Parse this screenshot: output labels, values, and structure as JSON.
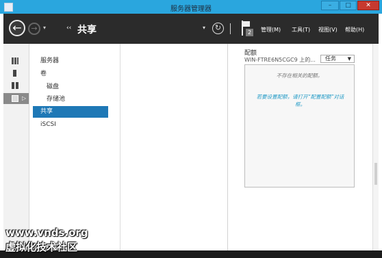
{
  "window": {
    "title": "服务器管理器",
    "controls": {
      "minimize": "–",
      "maximize": "□",
      "close": "✕"
    }
  },
  "toolbar": {
    "back_icon": "←",
    "forward_icon": "→",
    "dropdown_icon": "▾",
    "breadcrumb_arrows": "‹‹",
    "breadcrumb": "共享",
    "refresh_icon": "↻",
    "notification_count": "2",
    "menus": [
      {
        "label": "管理(M)"
      },
      {
        "label": "工具(T)"
      },
      {
        "label": "视图(V)"
      },
      {
        "label": "帮助(H)"
      }
    ]
  },
  "rail": {
    "icons": [
      "dashboard-icon",
      "local-server-icon",
      "all-servers-icon",
      "file-services-icon"
    ],
    "active_arrow": "▷"
  },
  "sidebar": {
    "items": [
      {
        "label": "服务器",
        "level": 0,
        "selected": false
      },
      {
        "label": "卷",
        "level": 0,
        "selected": false
      },
      {
        "label": "磁盘",
        "level": 1,
        "selected": false
      },
      {
        "label": "存储池",
        "level": 1,
        "selected": false
      },
      {
        "label": "共享",
        "level": 0,
        "selected": true
      },
      {
        "label": "iSCSI",
        "level": 0,
        "selected": false
      }
    ]
  },
  "right_panel": {
    "title": "配额",
    "subtitle": "WIN-FTRE6N5CGC9 上的...",
    "tasks_label": "任务",
    "tasks_caret": "▼",
    "empty_message": "不存在相关的配额。",
    "help_text": "若要设置配额，请打开“配置配额”对话框。"
  },
  "watermark": {
    "url": "www.vnds.org",
    "name": "虚拟化技术社区"
  },
  "colors": {
    "titlebar": "#2aa6de",
    "toolbar": "#2b2b2b",
    "selection": "#1e78b6",
    "link": "#2a9ec8"
  }
}
